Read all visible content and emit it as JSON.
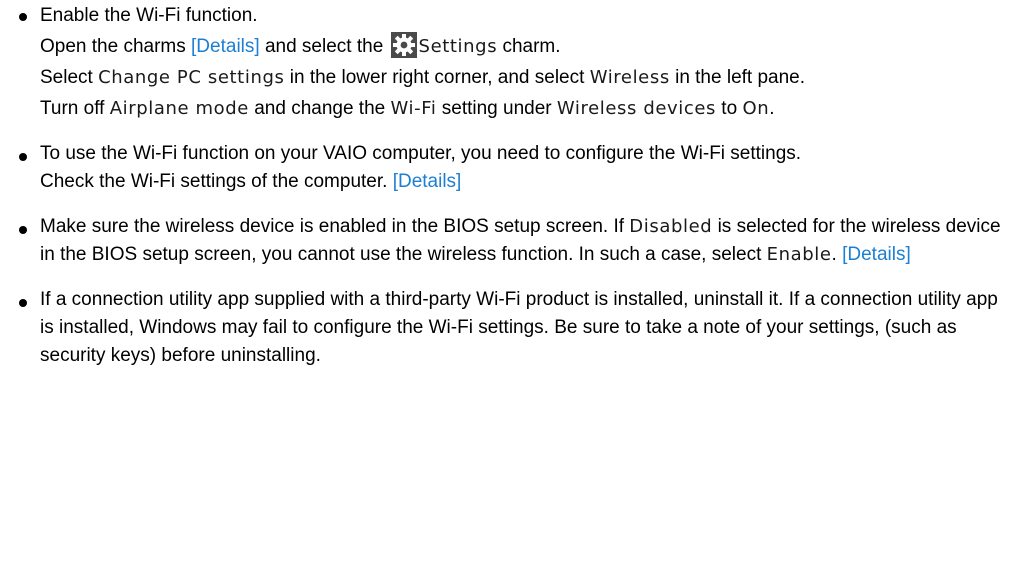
{
  "items": [
    {
      "id": "enable-wifi",
      "text_a": "Enable the Wi-Fi function.",
      "text_b1": "Open the charms ",
      "link_1": "[Details]",
      "text_b2": " and select the ",
      "ui_settings": "Settings",
      "text_b3": " charm.",
      "text_c1": "Select ",
      "ui_change_pc": "Change PC settings",
      "text_c2": " in the lower right corner, and select ",
      "ui_wireless": "Wireless",
      "text_c3": " in the left pane.",
      "text_d1": "Turn off ",
      "ui_airplane": "Airplane mode",
      "text_d2": " and change the ",
      "ui_wifi": "Wi-Fi",
      "text_d3": " setting under ",
      "ui_wireless_devices": "Wireless devices",
      "text_d4": " to ",
      "ui_on": "On",
      "text_d5": "."
    },
    {
      "id": "configure-wifi",
      "text_a": "To use the Wi-Fi function on your VAIO computer, you need to configure the Wi-Fi settings.",
      "text_b1": "Check the Wi-Fi settings of the computer. ",
      "link_1": "[Details]"
    },
    {
      "id": "bios",
      "text_a1": "Make sure the wireless device is enabled in the BIOS setup screen. If ",
      "ui_disabled": "Disabled",
      "text_a2": " is selected for the wireless device in the BIOS setup screen, you cannot use the wireless function. In such a case, select ",
      "ui_enable": "Enable",
      "text_a3": ". ",
      "link_1": "[Details]"
    },
    {
      "id": "utility-app",
      "text_a": "If a connection utility app supplied with a third-party Wi-Fi product is installed, uninstall it. If a connection utility app is installed, Windows may fail to configure the Wi-Fi settings. Be sure to take a note of your settings, (such as security keys) before uninstalling."
    }
  ],
  "icons": {
    "settings": "gear-icon"
  },
  "colors": {
    "link": "#1c7fd1",
    "text": "#000000",
    "icon_bg": "#4a4a4a"
  }
}
